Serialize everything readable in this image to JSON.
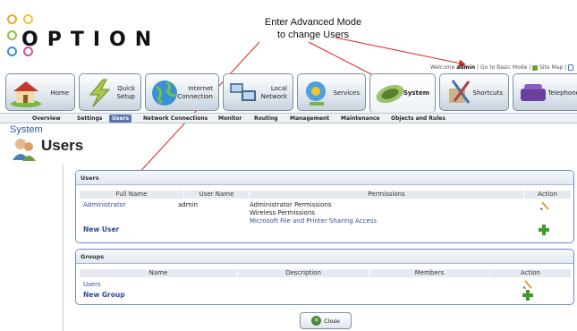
{
  "logo": {
    "text": "OPTION"
  },
  "annotation": {
    "line1": "Enter Advanced Mode",
    "line2": "to change Users"
  },
  "welcome": {
    "prefix": "Welcome",
    "user": "admin",
    "basic_mode": "Go to Basic Mode",
    "site_map": "Site Map"
  },
  "tabs": [
    {
      "label": "Home",
      "icon": "house-icon"
    },
    {
      "label": "Quick\nSetup",
      "icon": "lightning-icon"
    },
    {
      "label": "Internet\nConnection",
      "icon": "globe-icon"
    },
    {
      "label": "Local\nNetwork",
      "icon": "computers-icon"
    },
    {
      "label": "Services",
      "icon": "services-icon"
    },
    {
      "label": "System",
      "icon": "system-icon"
    },
    {
      "label": "Shortcuts",
      "icon": "tools-icon"
    },
    {
      "label": "Telephone",
      "icon": "telephone-icon"
    }
  ],
  "subnav": [
    "Overview",
    "Settings",
    "Users",
    "Network Connections",
    "Monitor",
    "Routing",
    "Management",
    "Maintenance",
    "Objects and Rules"
  ],
  "breadcrumb": "System",
  "page_title": "Users",
  "users_panel": {
    "title": "Users",
    "columns": [
      "Full Name",
      "User Name",
      "Permissions",
      "Action"
    ],
    "rows": [
      {
        "full_name": "Administrator",
        "user_name": "admin",
        "permissions": [
          "Administrator Permissions",
          "Wireless Permissions",
          "Microsoft File and Printer Sharing Access"
        ]
      }
    ],
    "new_label": "New User"
  },
  "groups_panel": {
    "title": "Groups",
    "columns": [
      "Name",
      "Description",
      "Members",
      "Action"
    ],
    "rows": [
      {
        "name": "Users",
        "description": "",
        "members": ""
      }
    ],
    "new_label": "New Group"
  },
  "close_label": "Close",
  "colors": {
    "accent": "#5874a8",
    "link": "#2a4fa0",
    "panel_border": "#6d8cc6",
    "add_green": "#3f9a2a",
    "annotation_red": "#e02020"
  }
}
